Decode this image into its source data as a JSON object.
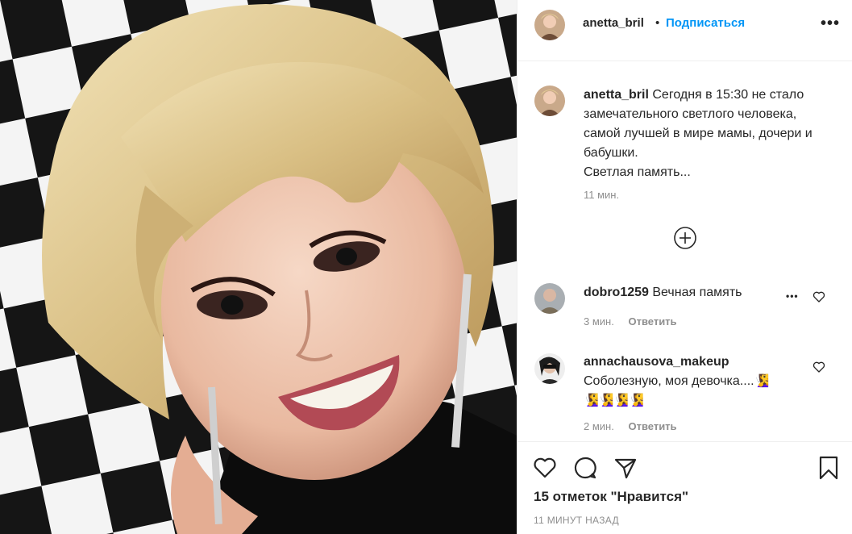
{
  "post": {
    "author": "anetta_bril",
    "separator": "•",
    "follow_label": "Подписаться",
    "more_label": "•••",
    "photo_alt": "Post photo"
  },
  "caption": {
    "username": "anetta_bril",
    "text": "Сегодня в 15:30 не стало замечательного светлого человека, самой лучшей в мире мамы, дочери и бабушки.\nСветлая память...",
    "time": "11 мин."
  },
  "load_more": {
    "icon": "plus-circle-icon"
  },
  "comments": [
    {
      "username": "dobro1259",
      "text": "Вечная память",
      "time": "3 мин.",
      "reply": "Ответить"
    },
    {
      "username": "annachausova_makeup",
      "text": "Соболезную, моя девочка....",
      "emoji_inline": "🧏‍♀️",
      "emoji_line": "🧏‍♀️🧏‍♀️🧏‍♀️🧏‍♀️",
      "time": "2 мин.",
      "reply": "Ответить"
    }
  ],
  "footer": {
    "likes": "15 отметок \"Нравится\"",
    "time_ago": "11 МИНУТ НАЗАД"
  },
  "colors": {
    "accent": "#0095f6",
    "muted": "#8e8e8e",
    "text": "#262626",
    "border": "#efefef"
  }
}
